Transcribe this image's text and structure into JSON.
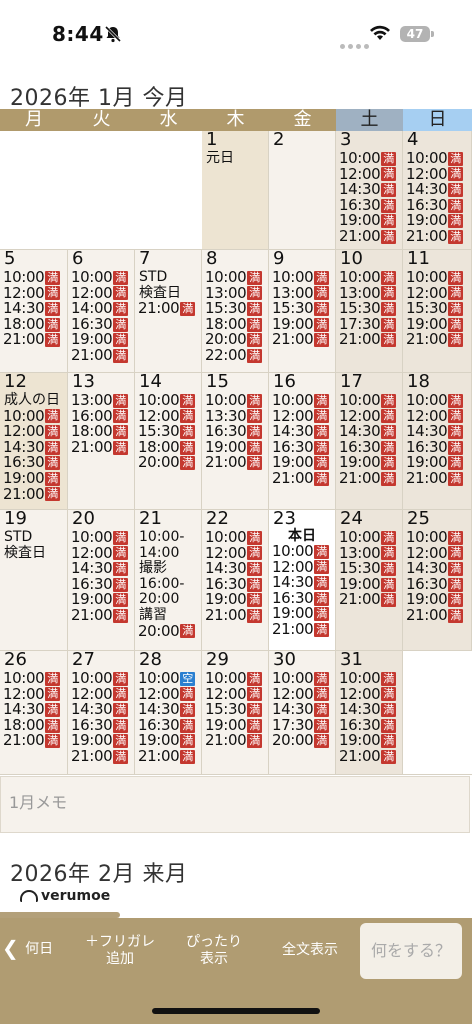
{
  "status": {
    "time": "8:44",
    "battery": "47"
  },
  "month1": {
    "title": "2026年 1月 今月"
  },
  "month2": {
    "title": "2026年 2月 来月"
  },
  "weekdays": [
    "月",
    "火",
    "水",
    "木",
    "金",
    "土",
    "日"
  ],
  "calendar": {
    "weeks": [
      [
        {
          "empty": true
        },
        {
          "empty": true
        },
        {
          "empty": true
        },
        {
          "day": "1",
          "note": [
            "元日"
          ],
          "type": "holiday",
          "slots": []
        },
        {
          "day": "2",
          "slots": []
        },
        {
          "day": "3",
          "type": "weekend",
          "slots": [
            [
              "10:00",
              "満"
            ],
            [
              "12:00",
              "満"
            ],
            [
              "14:30",
              "満"
            ],
            [
              "16:30",
              "満"
            ],
            [
              "19:00",
              "満"
            ],
            [
              "21:00",
              "満"
            ]
          ]
        },
        {
          "day": "4",
          "type": "weekend",
          "slots": [
            [
              "10:00",
              "満"
            ],
            [
              "12:00",
              "満"
            ],
            [
              "14:30",
              "満"
            ],
            [
              "16:30",
              "満"
            ],
            [
              "19:00",
              "満"
            ],
            [
              "21:00",
              "満"
            ]
          ]
        }
      ],
      [
        {
          "day": "5",
          "slots": [
            [
              "10:00",
              "満"
            ],
            [
              "12:00",
              "満"
            ],
            [
              "14:30",
              "満"
            ],
            [
              "18:00",
              "満"
            ],
            [
              "21:00",
              "満"
            ]
          ]
        },
        {
          "day": "6",
          "slots": [
            [
              "10:00",
              "満"
            ],
            [
              "12:00",
              "満"
            ],
            [
              "14:00",
              "満"
            ],
            [
              "16:30",
              "満"
            ],
            [
              "19:00",
              "満"
            ],
            [
              "21:00",
              "満"
            ]
          ]
        },
        {
          "day": "7",
          "note": [
            "STD",
            "検査日"
          ],
          "slots": [
            [
              "21:00",
              "満"
            ]
          ]
        },
        {
          "day": "8",
          "slots": [
            [
              "10:00",
              "満"
            ],
            [
              "13:00",
              "満"
            ],
            [
              "15:30",
              "満"
            ],
            [
              "18:00",
              "満"
            ],
            [
              "20:00",
              "満"
            ],
            [
              "22:00",
              "満"
            ]
          ]
        },
        {
          "day": "9",
          "slots": [
            [
              "10:00",
              "満"
            ],
            [
              "13:00",
              "満"
            ],
            [
              "15:30",
              "満"
            ],
            [
              "19:00",
              "満"
            ],
            [
              "21:00",
              "満"
            ]
          ]
        },
        {
          "day": "10",
          "type": "weekend",
          "slots": [
            [
              "10:00",
              "満"
            ],
            [
              "13:00",
              "満"
            ],
            [
              "15:30",
              "満"
            ],
            [
              "17:30",
              "満"
            ],
            [
              "21:00",
              "満"
            ]
          ]
        },
        {
          "day": "11",
          "type": "weekend",
          "slots": [
            [
              "10:00",
              "満"
            ],
            [
              "12:00",
              "満"
            ],
            [
              "15:30",
              "満"
            ],
            [
              "19:00",
              "満"
            ],
            [
              "21:00",
              "満"
            ]
          ]
        }
      ],
      [
        {
          "day": "12",
          "note": [
            "成人の日"
          ],
          "type": "holiday",
          "slots": [
            [
              "10:00",
              "満"
            ],
            [
              "12:00",
              "満"
            ],
            [
              "14:30",
              "満"
            ],
            [
              "16:30",
              "満"
            ],
            [
              "19:00",
              "満"
            ],
            [
              "21:00",
              "満"
            ]
          ]
        },
        {
          "day": "13",
          "slots": [
            [
              "13:00",
              "満"
            ],
            [
              "16:00",
              "満"
            ],
            [
              "18:00",
              "満"
            ],
            [
              "21:00",
              "満"
            ]
          ]
        },
        {
          "day": "14",
          "slots": [
            [
              "10:00",
              "満"
            ],
            [
              "12:00",
              "満"
            ],
            [
              "15:30",
              "満"
            ],
            [
              "18:00",
              "満"
            ],
            [
              "20:00",
              "満"
            ]
          ]
        },
        {
          "day": "15",
          "slots": [
            [
              "10:00",
              "満"
            ],
            [
              "13:30",
              "満"
            ],
            [
              "16:30",
              "満"
            ],
            [
              "19:00",
              "満"
            ],
            [
              "21:00",
              "満"
            ]
          ]
        },
        {
          "day": "16",
          "slots": [
            [
              "10:00",
              "満"
            ],
            [
              "12:00",
              "満"
            ],
            [
              "14:30",
              "満"
            ],
            [
              "16:30",
              "満"
            ],
            [
              "19:00",
              "満"
            ],
            [
              "21:00",
              "満"
            ]
          ]
        },
        {
          "day": "17",
          "type": "weekend",
          "slots": [
            [
              "10:00",
              "満"
            ],
            [
              "12:00",
              "満"
            ],
            [
              "14:30",
              "満"
            ],
            [
              "16:30",
              "満"
            ],
            [
              "19:00",
              "満"
            ],
            [
              "21:00",
              "満"
            ]
          ]
        },
        {
          "day": "18",
          "type": "weekend",
          "slots": [
            [
              "10:00",
              "満"
            ],
            [
              "12:00",
              "満"
            ],
            [
              "14:30",
              "満"
            ],
            [
              "16:30",
              "満"
            ],
            [
              "19:00",
              "満"
            ],
            [
              "21:00",
              "満"
            ]
          ]
        }
      ],
      [
        {
          "day": "19",
          "note": [
            "STD",
            "検査日"
          ],
          "slots": []
        },
        {
          "day": "20",
          "slots": [
            [
              "10:00",
              "満"
            ],
            [
              "12:00",
              "満"
            ],
            [
              "14:30",
              "満"
            ],
            [
              "16:30",
              "満"
            ],
            [
              "19:00",
              "満"
            ],
            [
              "21:00",
              "満"
            ]
          ]
        },
        {
          "day": "21",
          "note": [
            "10:00-",
            "14:00",
            "撮影",
            "16:00-",
            "20:00",
            "講習"
          ],
          "slots": [
            [
              "20:00",
              "満"
            ]
          ]
        },
        {
          "day": "22",
          "slots": [
            [
              "10:00",
              "満"
            ],
            [
              "12:00",
              "満"
            ],
            [
              "14:30",
              "満"
            ],
            [
              "16:30",
              "満"
            ],
            [
              "19:00",
              "満"
            ],
            [
              "21:00",
              "満"
            ]
          ]
        },
        {
          "day": "23",
          "type": "today",
          "todayLabel": "本日",
          "slots": [
            [
              "10:00",
              "満"
            ],
            [
              "12:00",
              "満"
            ],
            [
              "14:30",
              "満"
            ],
            [
              "16:30",
              "満"
            ],
            [
              "19:00",
              "満"
            ],
            [
              "21:00",
              "満"
            ]
          ]
        },
        {
          "day": "24",
          "type": "weekend",
          "slots": [
            [
              "10:00",
              "満"
            ],
            [
              "13:00",
              "満"
            ],
            [
              "15:30",
              "満"
            ],
            [
              "19:00",
              "満"
            ],
            [
              "21:00",
              "満"
            ]
          ]
        },
        {
          "day": "25",
          "type": "weekend",
          "slots": [
            [
              "10:00",
              "満"
            ],
            [
              "12:00",
              "満"
            ],
            [
              "14:30",
              "満"
            ],
            [
              "16:30",
              "満"
            ],
            [
              "19:00",
              "満"
            ],
            [
              "21:00",
              "満"
            ]
          ]
        }
      ],
      [
        {
          "day": "26",
          "slots": [
            [
              "10:00",
              "満"
            ],
            [
              "12:00",
              "満"
            ],
            [
              "14:30",
              "満"
            ],
            [
              "18:00",
              "満"
            ],
            [
              "21:00",
              "満"
            ]
          ]
        },
        {
          "day": "27",
          "slots": [
            [
              "10:00",
              "満"
            ],
            [
              "12:00",
              "満"
            ],
            [
              "14:30",
              "満"
            ],
            [
              "16:30",
              "満"
            ],
            [
              "19:00",
              "満"
            ],
            [
              "21:00",
              "満"
            ]
          ]
        },
        {
          "day": "28",
          "slots": [
            [
              "10:00",
              "空"
            ],
            [
              "12:00",
              "満"
            ],
            [
              "14:30",
              "満"
            ],
            [
              "16:30",
              "満"
            ],
            [
              "19:00",
              "満"
            ],
            [
              "21:00",
              "満"
            ]
          ]
        },
        {
          "day": "29",
          "slots": [
            [
              "10:00",
              "満"
            ],
            [
              "12:00",
              "満"
            ],
            [
              "15:30",
              "満"
            ],
            [
              "19:00",
              "満"
            ],
            [
              "21:00",
              "満"
            ]
          ]
        },
        {
          "day": "30",
          "slots": [
            [
              "10:00",
              "満"
            ],
            [
              "12:00",
              "満"
            ],
            [
              "14:30",
              "満"
            ],
            [
              "17:30",
              "満"
            ],
            [
              "20:00",
              "満"
            ]
          ]
        },
        {
          "day": "31",
          "type": "weekend",
          "slots": [
            [
              "10:00",
              "満"
            ],
            [
              "12:00",
              "満"
            ],
            [
              "14:30",
              "満"
            ],
            [
              "16:30",
              "満"
            ],
            [
              "19:00",
              "満"
            ],
            [
              "21:00",
              "満"
            ]
          ]
        },
        {
          "empty": true
        }
      ]
    ]
  },
  "memo": {
    "placeholder": "1月メモ"
  },
  "logo": {
    "text": "verumoe"
  },
  "toolbar": {
    "back_label": "何日",
    "furigana_label_1": "＋フリガレ",
    "furigana_label_2": "追加",
    "fit_label_1": "ぴったり",
    "fit_label_2": "表示",
    "fulltext_label": "全文表示",
    "action_label": "何をする？"
  },
  "colors": {
    "accent": "#b09a6c",
    "full_badge": "#c4382f",
    "available_badge": "#2a7fd0",
    "saturday": "#9fb1c2",
    "sunday": "#a6cff2"
  }
}
